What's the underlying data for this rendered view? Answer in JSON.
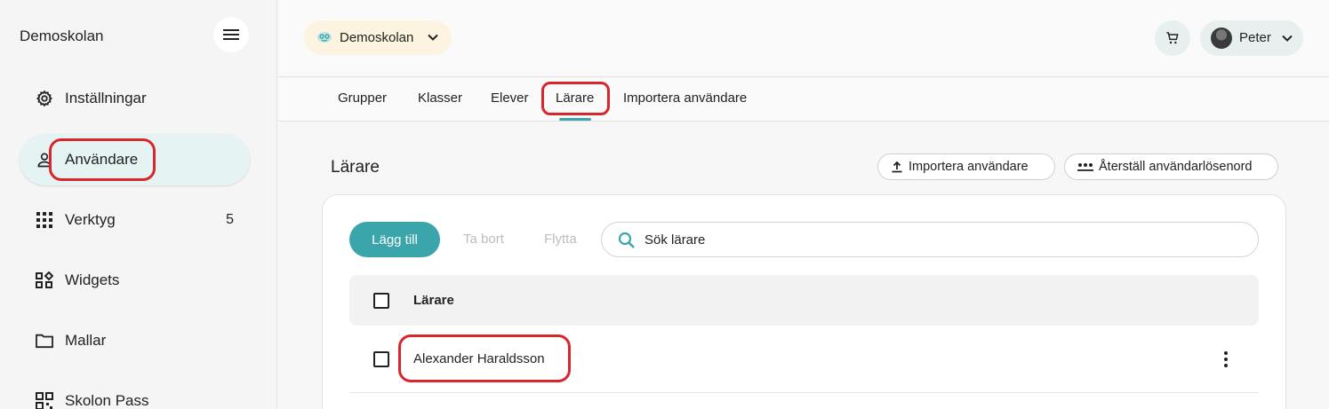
{
  "sidebar": {
    "brand": "Demoskolan",
    "items": [
      {
        "label": "Inställningar",
        "icon": "gear-icon",
        "count": ""
      },
      {
        "label": "Användare",
        "icon": "person-icon",
        "count": ""
      },
      {
        "label": "Verktyg",
        "icon": "grid-icon",
        "count": "5"
      },
      {
        "label": "Widgets",
        "icon": "widgets-icon",
        "count": ""
      },
      {
        "label": "Mallar",
        "icon": "folder-icon",
        "count": ""
      },
      {
        "label": "Skolon Pass",
        "icon": "qr-code-icon",
        "count": ""
      }
    ]
  },
  "header": {
    "school": "Demoskolan",
    "user": "Peter"
  },
  "tabs": [
    "Grupper",
    "Klasser",
    "Elever",
    "Lärare",
    "Importera användare"
  ],
  "main": {
    "title": "Lärare",
    "import_button": "Importera användare",
    "reset_button": "Återställ användarlösenord",
    "add_button": "Lägg till",
    "remove_button": "Ta bort",
    "move_button": "Flytta",
    "search_placeholder": "Sök lärare",
    "column_header": "Lärare",
    "rows": [
      {
        "name": "Alexander Haraldsson"
      }
    ]
  },
  "colors": {
    "accent": "#3aa6ac",
    "active_nav_bg": "#e6f3f3",
    "school_pill_bg": "#fdf3e1",
    "highlight": "#d8262d"
  }
}
